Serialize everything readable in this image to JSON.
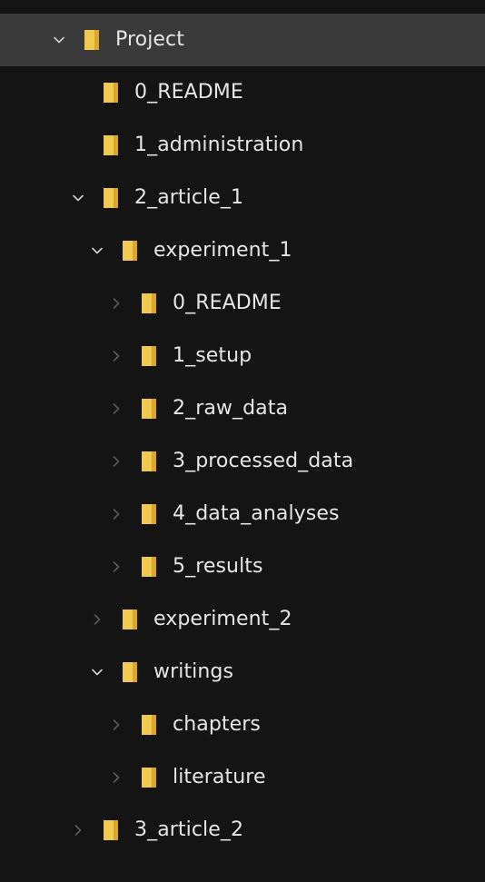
{
  "colors": {
    "background": "#141414",
    "selected_row": "#3a3a3a",
    "text": "#e6e6e6",
    "chevron_expanded": "#d0d0d0",
    "chevron_collapsed": "#5a5a5a",
    "folder_front": "#f0c94e",
    "folder_back": "#d9a730"
  },
  "tree": {
    "items": [
      {
        "label": "Project",
        "level": 0,
        "state": "expanded",
        "selected": true
      },
      {
        "label": "0_README",
        "level": 1,
        "state": "leaf"
      },
      {
        "label": "1_administration",
        "level": 1,
        "state": "leaf"
      },
      {
        "label": "2_article_1",
        "level": 1,
        "state": "expanded"
      },
      {
        "label": "experiment_1",
        "level": 2,
        "state": "expanded"
      },
      {
        "label": "0_README",
        "level": 3,
        "state": "collapsed"
      },
      {
        "label": "1_setup",
        "level": 3,
        "state": "collapsed"
      },
      {
        "label": "2_raw_data",
        "level": 3,
        "state": "collapsed"
      },
      {
        "label": "3_processed_data",
        "level": 3,
        "state": "collapsed"
      },
      {
        "label": "4_data_analyses",
        "level": 3,
        "state": "collapsed"
      },
      {
        "label": "5_results",
        "level": 3,
        "state": "collapsed"
      },
      {
        "label": "experiment_2",
        "level": 2,
        "state": "collapsed"
      },
      {
        "label": "writings",
        "level": 2,
        "state": "expanded"
      },
      {
        "label": "chapters",
        "level": 3,
        "state": "collapsed"
      },
      {
        "label": "literature",
        "level": 3,
        "state": "collapsed"
      },
      {
        "label": "3_article_2",
        "level": 1,
        "state": "collapsed"
      }
    ]
  }
}
